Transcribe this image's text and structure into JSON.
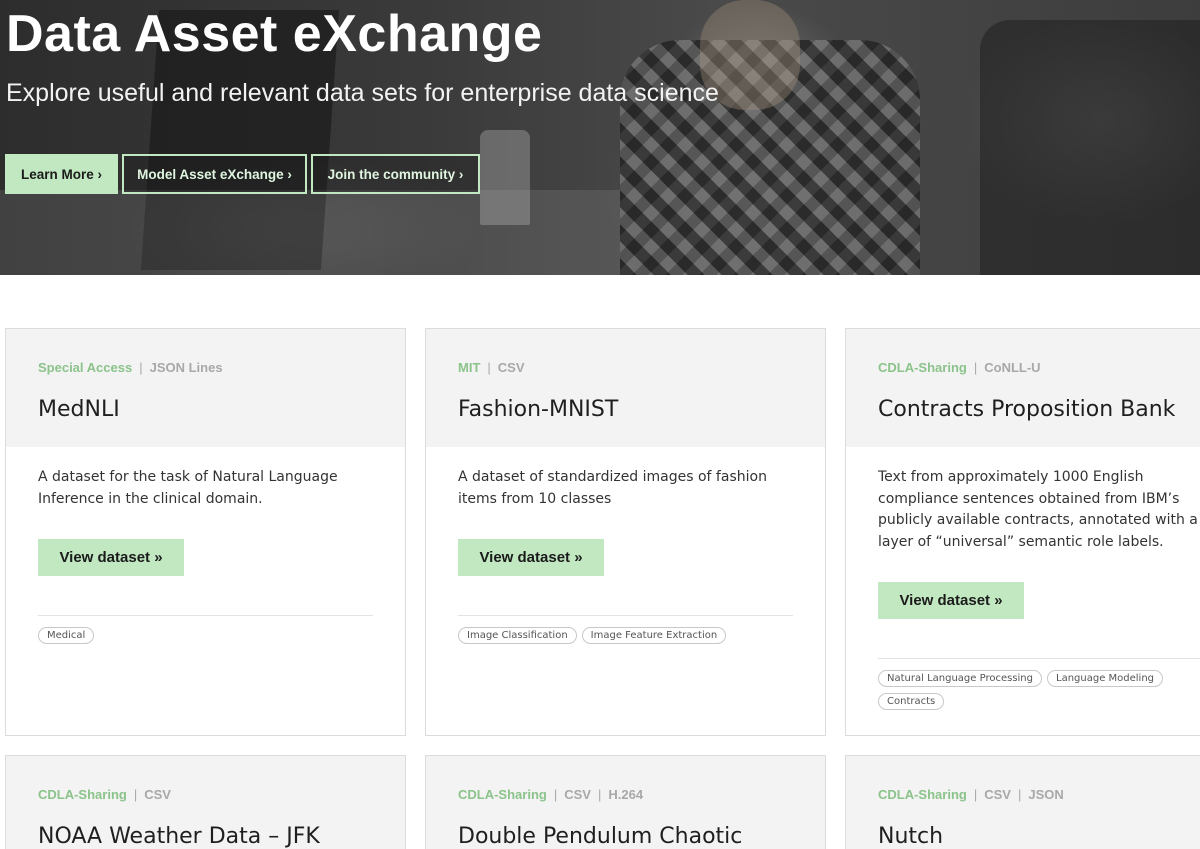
{
  "hero": {
    "title": "Data Asset eXchange",
    "subtitle": "Explore useful and relevant data sets for enterprise data science",
    "buttons": {
      "learn_more": "Learn More ›",
      "max": "Model Asset eXchange ›",
      "community": "Join the community ›"
    }
  },
  "colors": {
    "accent": "#c1e8c1",
    "license_text": "#8bc38b",
    "card_header": "#f3f3f3"
  },
  "view_label": "View dataset »",
  "cards": [
    {
      "license": "Special Access",
      "formats": [
        "JSON Lines"
      ],
      "title": "MedNLI",
      "description": "A dataset for the task of Natural Language Inference in the clinical domain.",
      "tags": [
        "Medical"
      ]
    },
    {
      "license": "MIT",
      "formats": [
        "CSV"
      ],
      "title": "Fashion-MNIST",
      "description": "A dataset of standardized images of fashion items from 10 classes",
      "tags": [
        "Image Classification",
        "Image Feature Extraction"
      ]
    },
    {
      "license": "CDLA-Sharing",
      "formats": [
        "CoNLL-U"
      ],
      "title": "Contracts Proposition Bank",
      "description": "Text from approximately 1000 English compliance sentences obtained from IBM’s publicly available contracts, annotated with a layer of “universal” semantic role labels.",
      "tags": [
        "Natural Language Processing",
        "Language Modeling",
        "Contracts"
      ]
    },
    {
      "license": "CDLA-Sharing",
      "formats": [
        "CSV"
      ],
      "title": "NOAA Weather Data – JFK"
    },
    {
      "license": "CDLA-Sharing",
      "formats": [
        "CSV",
        "H.264"
      ],
      "title": "Double Pendulum Chaotic"
    },
    {
      "license": "CDLA-Sharing",
      "formats": [
        "CSV",
        "JSON"
      ],
      "title": "Nutch"
    }
  ]
}
